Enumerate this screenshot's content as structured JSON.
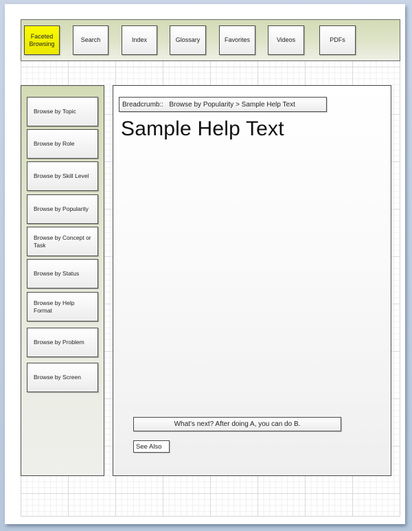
{
  "topnav": {
    "items": [
      {
        "label": "Faceted\nBrowsing",
        "active": true
      },
      {
        "label": "Search",
        "active": false
      },
      {
        "label": "Index",
        "active": false
      },
      {
        "label": "Glossary",
        "active": false
      },
      {
        "label": "Favorites",
        "active": false
      },
      {
        "label": "Videos",
        "active": false
      },
      {
        "label": "PDFs",
        "active": false
      }
    ],
    "active_color": "#f7f300"
  },
  "sidebar": {
    "items": [
      {
        "label": "Browse by Topic"
      },
      {
        "label": "Browse by Role"
      },
      {
        "label": "Browse by Skill Level"
      },
      {
        "label": "Browse by Popularity"
      },
      {
        "label": "Browse by Concept or Task"
      },
      {
        "label": "Browse by Status"
      },
      {
        "label": "Browse by Help Format"
      },
      {
        "label": "Browse by Problem"
      },
      {
        "label": "Browse by Screen"
      }
    ]
  },
  "content": {
    "breadcrumb": "Breadcrumb::   Browse by Popularity > Sample Help Text",
    "title": "Sample Help Text",
    "whats_next": "What’s next? After doing A, you can do B.",
    "see_also": "See Also"
  },
  "colors": {
    "panel_green": "#d3dbb6",
    "border": "#4a4a4a",
    "backdrop": "#c9d5e6"
  }
}
